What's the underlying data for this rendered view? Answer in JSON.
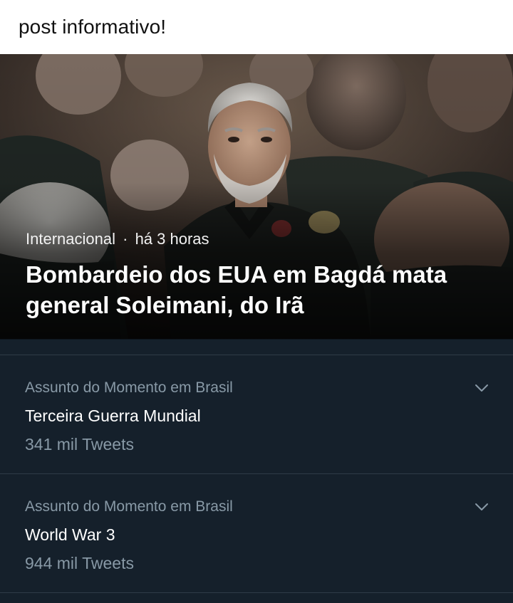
{
  "post": {
    "caption": "post informativo!"
  },
  "news_card": {
    "category": "Internacional",
    "separator": "·",
    "time": "há 3 horas",
    "headline": "Bombardeio dos EUA em Bagdá mata general Soleimani, do Irã"
  },
  "trends": [
    {
      "context": "Assunto do Momento em Brasil",
      "name": "Terceira Guerra Mundial",
      "count": "341 mil Tweets",
      "menu_icon": "chevron-down-icon"
    },
    {
      "context": "Assunto do Momento em Brasil",
      "name": "World War 3",
      "count": "944 mil Tweets",
      "menu_icon": "chevron-down-icon"
    }
  ],
  "colors": {
    "background": "#15202b",
    "secondary_text": "#8899a6",
    "primary_text": "#ffffff",
    "divider": "#2f3b47"
  }
}
